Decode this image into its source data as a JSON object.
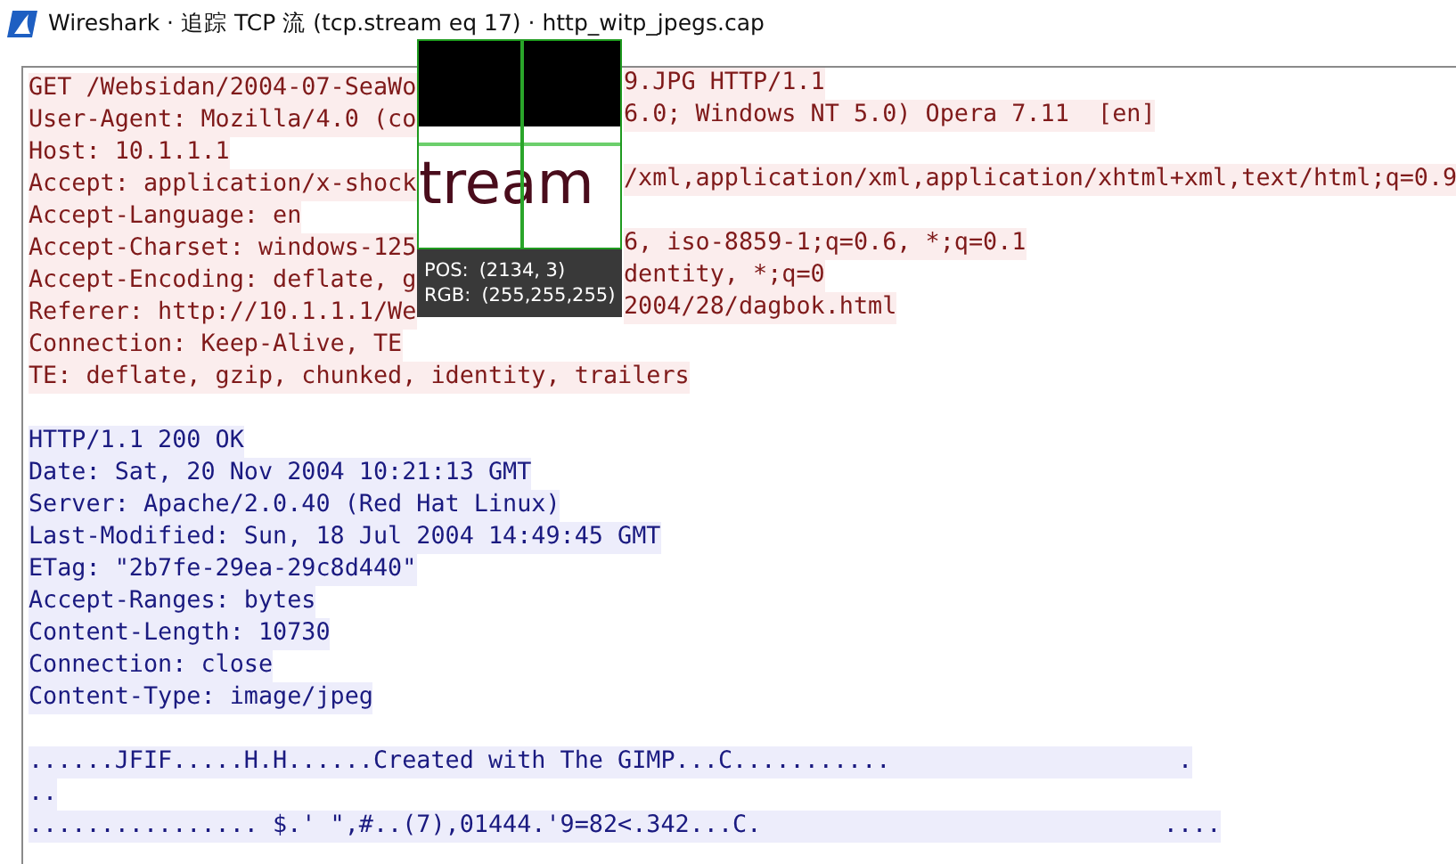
{
  "window": {
    "title": "Wireshark · 追踪 TCP 流 (tcp.stream eq 17) · http_witp_jpegs.cap"
  },
  "stream": [
    {
      "kind": "client",
      "lines": [
        {
          "text": "GET /Websidan/2004-07-SeaWo",
          "right": "9.JPG HTTP/1.1"
        },
        {
          "text": "User-Agent: Mozilla/4.0 (co",
          "right": "6.0; Windows NT 5.0) Opera 7.11  [en]"
        },
        {
          "text": "Host: 10.1.1.1"
        },
        {
          "text": "Accept: application/x-shock",
          "right": "/xml,application/xml,application/xhtml+xml,text/html;q=0.9"
        },
        {
          "text": "Accept-Language: en"
        },
        {
          "text": "Accept-Charset: windows-125",
          "right": "6, iso-8859-1;q=0.6, *;q=0.1"
        },
        {
          "text": "Accept-Encoding: deflate, g",
          "right": "dentity, *;q=0"
        },
        {
          "text": "Referer: http://10.1.1.1/We",
          "right": "2004/28/dagbok.html"
        },
        {
          "text": "Connection: Keep-Alive, TE"
        },
        {
          "text": "TE: deflate, gzip, chunked, identity, trailers"
        }
      ]
    },
    {
      "kind": "server",
      "lines": [
        {
          "text": "HTTP/1.1 200 OK"
        },
        {
          "text": "Date: Sat, 20 Nov 2004 10:21:13 GMT"
        },
        {
          "text": "Server: Apache/2.0.40 (Red Hat Linux)"
        },
        {
          "text": "Last-Modified: Sun, 18 Jul 2004 14:49:45 GMT"
        },
        {
          "text": "ETag: \"2b7fe-29ea-29c8d440\""
        },
        {
          "text": "Accept-Ranges: bytes"
        },
        {
          "text": "Content-Length: 10730"
        },
        {
          "text": "Connection: close"
        },
        {
          "text": "Content-Type: image/jpeg"
        }
      ]
    },
    {
      "kind": "server",
      "lines": [
        {
          "text": "......JFIF.....H.H......Created with The GIMP...C...........                    ."
        },
        {
          "text": ".."
        },
        {
          "text": "................ $.' \",#..(7),01444.'9=82<.342...C.                            ...."
        }
      ]
    }
  ],
  "magnifier": {
    "zoomed_text": "tream",
    "pos_label": "POS:",
    "pos_value": "(2134, 3)",
    "rgb_label": "RGB:",
    "rgb_value": "(255,255,255)"
  }
}
